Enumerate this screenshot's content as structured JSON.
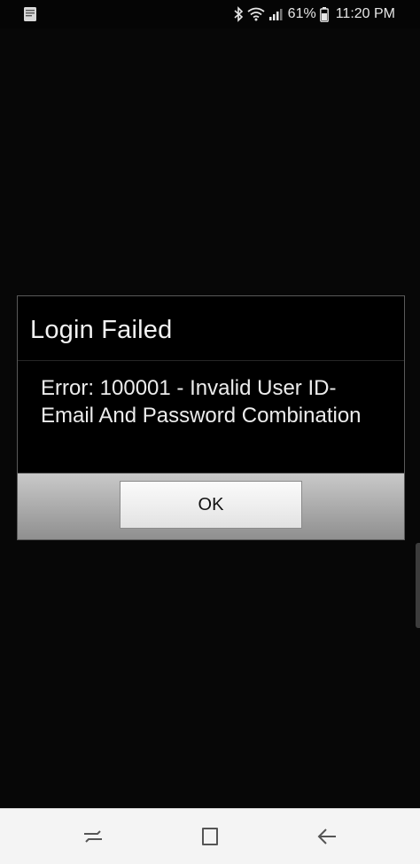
{
  "status_bar": {
    "battery": "61%",
    "time": "11:20 PM",
    "left_icon": "bible-app-notification-icon",
    "icons": [
      "bluetooth-icon",
      "wifi-icon",
      "signal-icon",
      "battery-icon"
    ]
  },
  "dialog": {
    "title": "Login Failed",
    "message": "Error: 100001 - Invalid User ID-Email And Password Combination",
    "ok_label": "OK"
  },
  "navigation": {
    "icons": [
      "recent-apps-icon",
      "home-icon",
      "back-icon"
    ]
  },
  "colors": {
    "background": "#070707",
    "dialog_background": "#000000",
    "footer_gray": "#a9a9a9",
    "nav_background": "#f4f4f4"
  }
}
